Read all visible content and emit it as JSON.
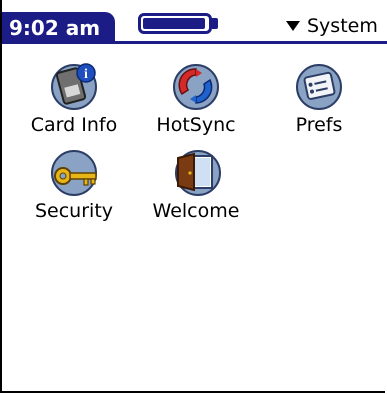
{
  "status_bar": {
    "time": "9:02 am",
    "battery_level": 0.97,
    "category": "System"
  },
  "apps": [
    {
      "label": "Card Info",
      "icon": "card-info-icon"
    },
    {
      "label": "HotSync",
      "icon": "hotsync-icon"
    },
    {
      "label": "Prefs",
      "icon": "prefs-icon"
    },
    {
      "label": "Security",
      "icon": "security-key-icon"
    },
    {
      "label": "Welcome",
      "icon": "welcome-door-icon"
    }
  ],
  "colors": {
    "title_bar": "#1c1c87",
    "icon_circle": "#8aa2c4"
  }
}
